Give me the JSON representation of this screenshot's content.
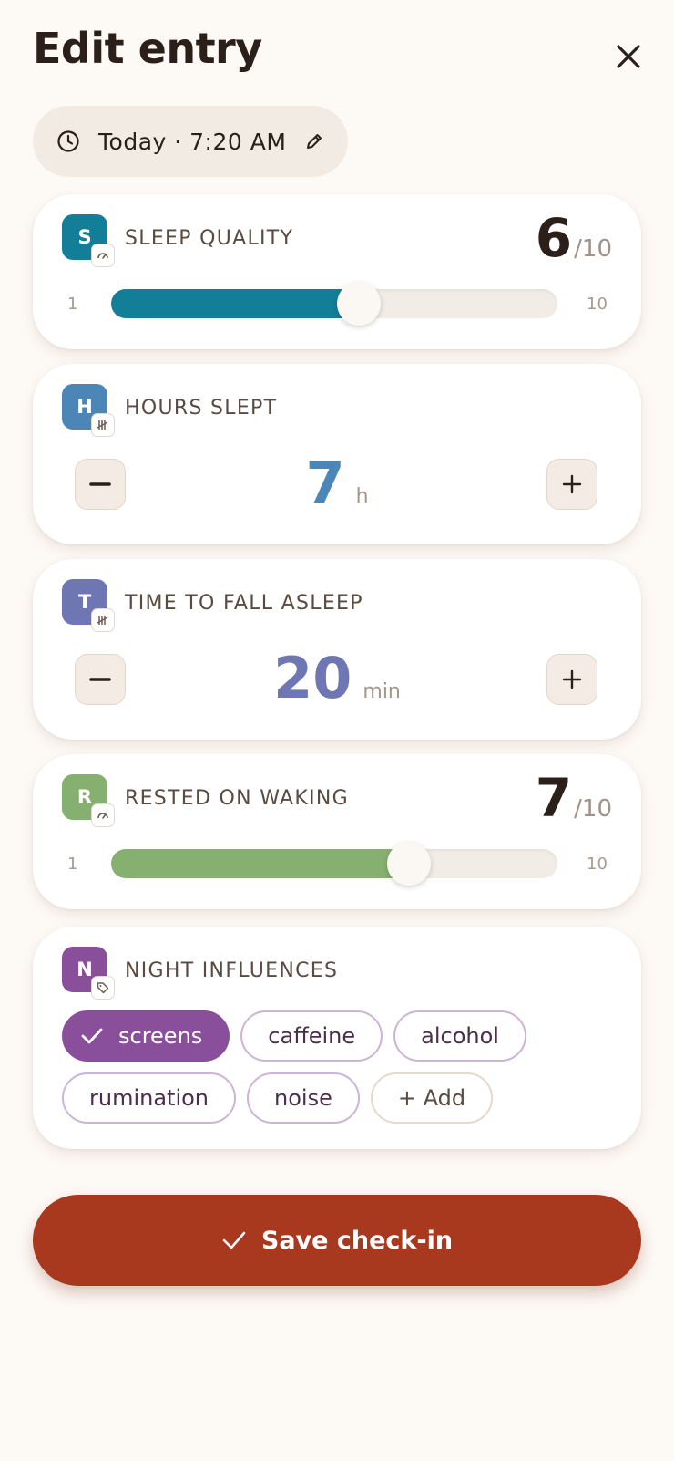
{
  "header": {
    "title": "Edit entry",
    "close_icon": "close-icon"
  },
  "datetime": {
    "label": "Today · 7:20 AM",
    "icon": "clock-icon",
    "edit_icon": "pencil-icon"
  },
  "sleep_quality": {
    "badge": "S",
    "label": "SLEEP QUALITY",
    "value": "6",
    "denominator": "/10",
    "min": "1",
    "max": "10",
    "fraction": 0.5556,
    "color": "#137e98"
  },
  "hours_slept": {
    "badge": "H",
    "label": "HOURS SLEPT",
    "value": "7",
    "unit": "h",
    "color": "#4b86b6"
  },
  "time_to_fall_asleep": {
    "badge": "T",
    "label": "TIME TO FALL ASLEEP",
    "value": "20",
    "unit": "min",
    "color": "#6e77b4"
  },
  "rested_on_waking": {
    "badge": "R",
    "label": "RESTED ON WAKING",
    "value": "7",
    "denominator": "/10",
    "min": "1",
    "max": "10",
    "fraction": 0.6667,
    "color": "#86b06f"
  },
  "night_influences": {
    "badge": "N",
    "label": "NIGHT INFLUENCES",
    "color": "#8a4f9b",
    "tags": [
      {
        "label": "screens",
        "selected": true
      },
      {
        "label": "caffeine",
        "selected": false
      },
      {
        "label": "alcohol",
        "selected": false
      },
      {
        "label": "rumination",
        "selected": false
      },
      {
        "label": "noise",
        "selected": false
      }
    ],
    "add_label": "+ Add"
  },
  "save": {
    "label": "Save check-in"
  }
}
